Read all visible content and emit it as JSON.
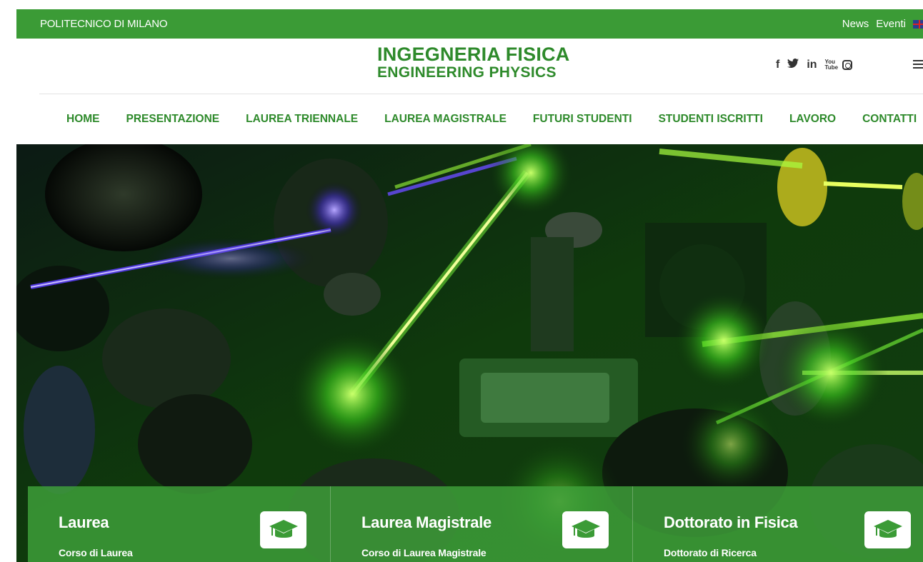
{
  "topbar": {
    "brand": "POLITECNICO DI MILANO",
    "links": [
      "News",
      "Eventi"
    ],
    "language_icon": "uk-flag-icon"
  },
  "header": {
    "title_line1": "INGEGNERIA FISICA",
    "title_line2": "ENGINEERING PHYSICS",
    "social": [
      "f",
      "✦",
      "in",
      "You Tube",
      "instagram-icon"
    ],
    "menu_icon": "hamburger-icon"
  },
  "nav": {
    "items": [
      "HOME",
      "PRESENTAZIONE",
      "LAUREA TRIENNALE",
      "LAUREA MAGISTRALE",
      "FUTURI STUDENTI",
      "STUDENTI ISCRITTI",
      "LAVORO",
      "CONTATTI"
    ]
  },
  "hero": {
    "image": "laser-optics-lab-photo"
  },
  "cards": [
    {
      "title": "Laurea",
      "subtitle": "Corso di Laurea",
      "icon": "graduation-cap-icon"
    },
    {
      "title": "Laurea Magistrale",
      "subtitle": "Corso di Laurea Magistrale",
      "icon": "graduation-cap-icon"
    },
    {
      "title": "Dottorato in Fisica",
      "subtitle": "Dottorato di Ricerca",
      "icon": "graduation-cap-icon"
    }
  ],
  "colors": {
    "brand_green": "#3b9b36",
    "title_green": "#2e8a2b"
  }
}
